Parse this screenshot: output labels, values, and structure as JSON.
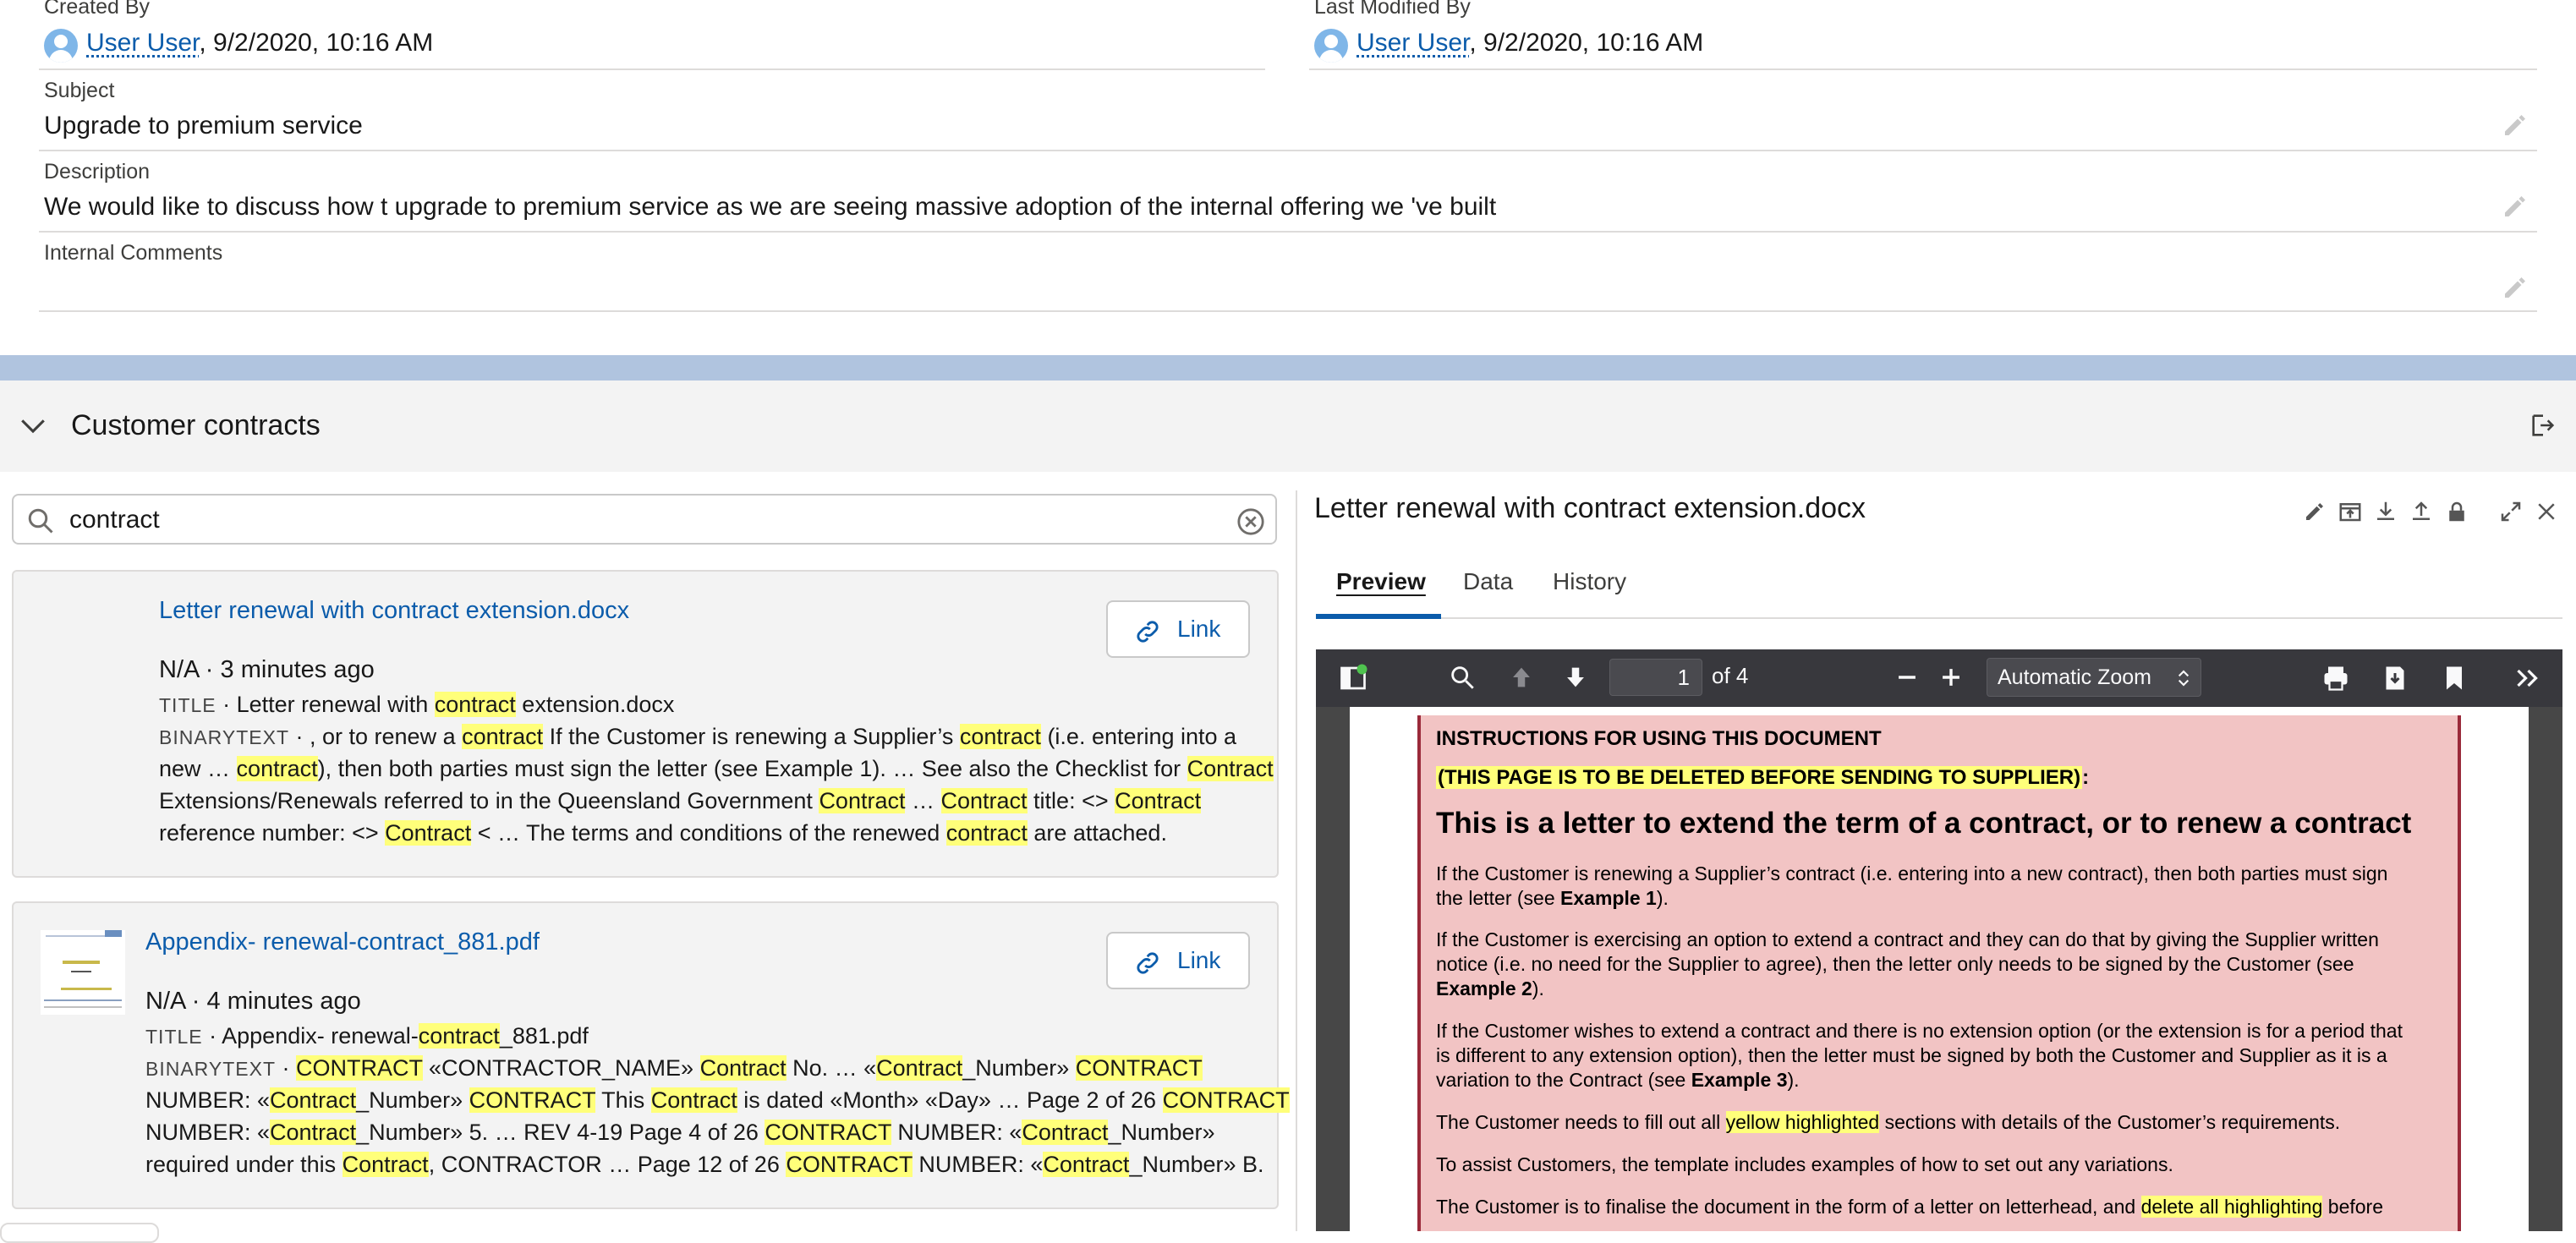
{
  "record": {
    "created_by_label": "Created By",
    "created_by_user": "User User",
    "created_by_date": ", 9/2/2020, 10:16 AM",
    "last_modified_label": "Last Modified By",
    "last_modified_user": "User User",
    "last_modified_date": ", 9/2/2020, 10:16 AM",
    "subject_label": "Subject",
    "subject_value": "Upgrade to premium service",
    "description_label": "Description",
    "description_value": "We would like to discuss how t upgrade to premium service as we are seeing massive adoption of the internal offering we 've built",
    "comments_label": "Internal Comments",
    "comments_value": ""
  },
  "section": {
    "title": "Customer contracts"
  },
  "search": {
    "value": "contract"
  },
  "results": [
    {
      "title": "Letter renewal with contract extension.docx",
      "meta_owner": "N/A",
      "meta_time": "3 minutes ago",
      "link_label": "Link",
      "title_field": "TITLE",
      "title_pre": "Letter renewal with ",
      "title_hl": "contract",
      "title_post": " extension.docx",
      "bin_field": "BINARYTEXT",
      "bin_lines": [
        [
          " , or to renew a ",
          "contract",
          " If the Customer is renewing a Supplier’s ",
          "contract",
          " (i.e. entering into a"
        ],
        [
          "new … ",
          "contract",
          "), then both parties must sign the letter (see Example 1). … See also the Checklist for ",
          "Contract",
          ""
        ],
        [
          "Extensions/Renewals referred to in the Queensland Government ",
          "Contract",
          " … ",
          "Contract",
          " title: <> ",
          "Contract",
          ""
        ],
        [
          "reference number: <> ",
          "Contract",
          " < … The terms and conditions of the renewed ",
          "contract",
          " are attached."
        ]
      ]
    },
    {
      "title": "Appendix- renewal-contract_881.pdf",
      "meta_owner": "N/A",
      "meta_time": "4 minutes ago",
      "link_label": "Link",
      "title_field": "TITLE",
      "title_pre": "Appendix- renewal-",
      "title_hl": "contract",
      "title_post": "_881.pdf",
      "bin_field": "BINARYTEXT",
      "bin_lines": [
        [
          "  ",
          "CONTRACT",
          " «CONTRACTOR_NAME» ",
          "Contract",
          " No. … «",
          "Contract",
          "_Number»  ",
          "CONTRACT",
          ""
        ],
        [
          "NUMBER: «",
          "Contract",
          "_Number» ",
          "CONTRACT",
          " This ",
          "Contract",
          " is dated «Month» «Day» … Page 2 of 26  ",
          "CONTRACT",
          ""
        ],
        [
          "NUMBER: «",
          "Contract",
          "_Number» 5. … REV 4-19 Page 4 of 26  ",
          "CONTRACT",
          " NUMBER: «",
          "Contract",
          "_Number»"
        ],
        [
          "required under this ",
          "Contract",
          ", CONTRACTOR … Page 12 of 26  ",
          "CONTRACT",
          " NUMBER: «",
          "Contract",
          "_Number» B."
        ]
      ]
    }
  ],
  "preview": {
    "title": "Letter renewal with contract extension.docx",
    "tabs": [
      "Preview",
      "Data",
      "History"
    ],
    "active_tab": "Preview"
  },
  "pdf": {
    "page_number": "1",
    "page_count": "of 4",
    "zoom": "Automatic Zoom",
    "heading1": "INSTRUCTIONS FOR USING THIS DOCUMENT",
    "heading2": "(THIS PAGE IS TO BE DELETED BEFORE SENDING TO SUPPLIER)",
    "heading2_suffix": ":",
    "big_title": "This is a letter to extend the term of a contract, or to renew a contract",
    "p1_l1": "If the Customer is renewing a Supplier’s contract (i.e. entering into a new contract), then both parties must sign",
    "p1_l2_pre": "the letter (see ",
    "p1_l2_bold": "Example 1",
    "p1_l2_post": ").",
    "p2_l1": "If the Customer is exercising an option to extend a contract and they can do that by giving the Supplier written",
    "p2_l2": "notice (i.e. no need for the Supplier to agree), then the letter only needs to be signed by the Customer (see",
    "p2_l3_bold": "Example 2",
    "p2_l3_post": ").",
    "p3_l1": "If the Customer wishes to extend a contract and there is no extension option (or the extension is for a period that",
    "p3_l2": "is different to any extension option), then the letter must be signed by both the Customer and Supplier as it is a",
    "p3_l3_pre": "variation to the Contract (see ",
    "p3_l3_bold": "Example 3",
    "p3_l3_post": ").",
    "p4_pre": "The Customer needs to fill out all ",
    "p4_hl": "yellow highlighted",
    "p4_post": " sections with details of the Customer’s requirements.",
    "p5": "To assist Customers, the template includes examples of how to set out any variations.",
    "p6_pre": "The Customer is to finalise the document in the form of a letter on letterhead, and  ",
    "p6_hl": "delete all highlighting",
    "p6_post": " before"
  },
  "colors": {
    "link": "#0b5cab",
    "highlight": "#ffff7a",
    "band": "#b0c4df",
    "pdf_page_tint": "#f2c4c4"
  }
}
